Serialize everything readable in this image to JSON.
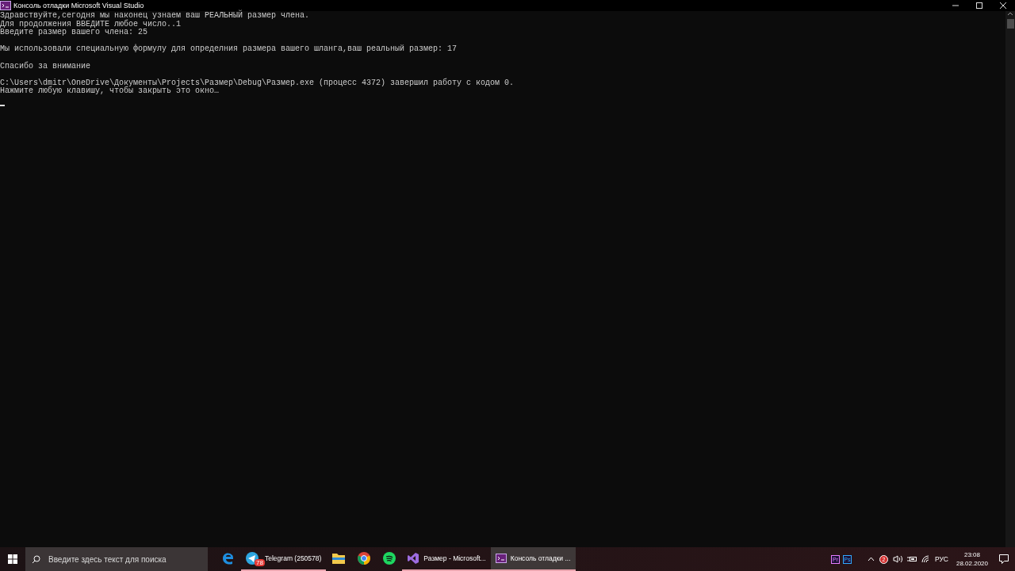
{
  "window": {
    "title": "Консоль отладки Microsoft Visual Studio"
  },
  "console": {
    "blocks": [
      [
        "Здравствуйте,сегодня мы наконец узнаем ваш РЕАЛЬНЫЙ размер члена.",
        "Для продолжения ВВЕДИТЕ любое число..1",
        "Введите размер вашего члена: 25"
      ],
      [
        "Мы использовали специальную формулу для определния размера вашего шланга,ваш реальный размер: 17"
      ],
      [
        "Спасибо за внимание"
      ],
      [
        "C:\\Users\\dmitr\\OneDrive\\Документы\\Projects\\Размер\\Debug\\Размер.exe (процесс 4372) завершил работу с кодом 0.",
        "Нажмите любую клавишу, чтобы закрыть это окно…"
      ]
    ]
  },
  "taskbar": {
    "search": {
      "placeholder": "Введите здесь текст для поиска"
    },
    "apps": [
      {
        "kind": "edge",
        "running": false,
        "selected": false
      },
      {
        "kind": "telegram",
        "label": "Telegram (250578)",
        "badge": "78",
        "running": true,
        "selected": false
      },
      {
        "kind": "folder",
        "running": false,
        "selected": false
      },
      {
        "kind": "chrome",
        "running": false,
        "selected": false
      },
      {
        "kind": "spotify",
        "running": false,
        "selected": false
      },
      {
        "kind": "vs",
        "label": "Размер - Microsoft...",
        "running": true,
        "selected": false
      },
      {
        "kind": "console",
        "label": "Консоль отладки ...",
        "running": true,
        "selected": true
      }
    ],
    "pinned": [
      "Pr",
      "Ps"
    ],
    "tray": {
      "notification_count": "2",
      "language": "РУС",
      "time": "23:08",
      "date": "28.02.2020"
    }
  }
}
